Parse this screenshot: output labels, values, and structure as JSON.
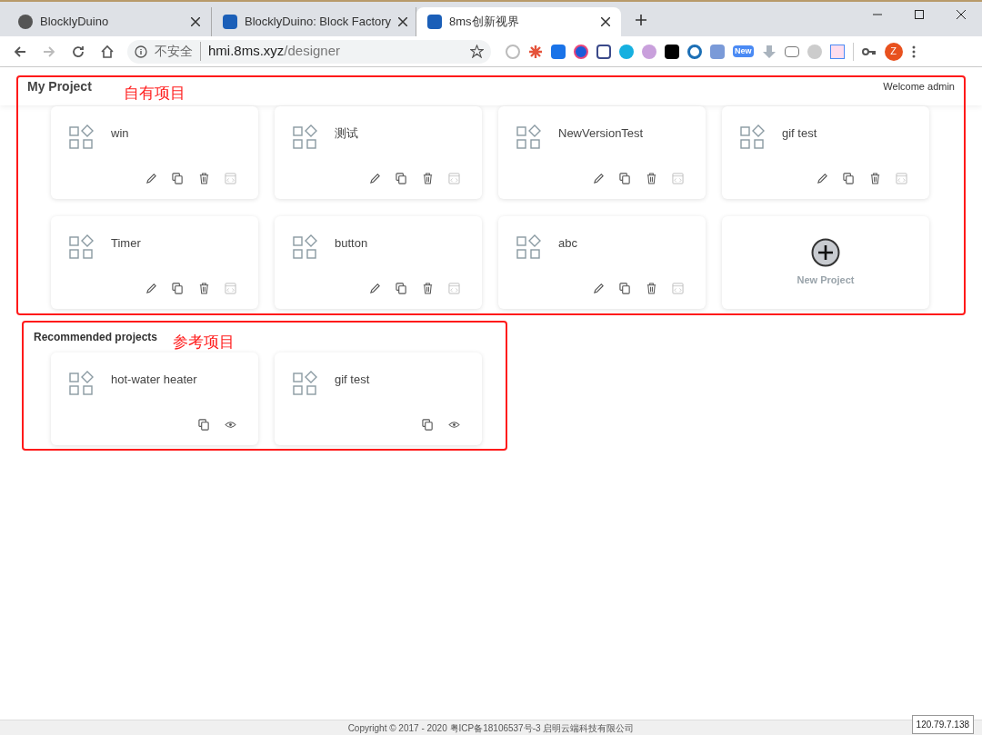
{
  "browser": {
    "tabs": [
      {
        "title": "BlocklyDuino",
        "selected": false
      },
      {
        "title": "BlocklyDuino: Block Factory",
        "selected": false
      },
      {
        "title": "8ms创新视界",
        "selected": true
      }
    ],
    "address": {
      "security": "不安全",
      "host": "hmi.8ms.xyz",
      "path": "/designer"
    },
    "extension_badge": "New",
    "avatar": "Z"
  },
  "header": {
    "title": "My Project",
    "welcome": "Welcome admin"
  },
  "my_projects": {
    "annotation": "自有项目",
    "items": [
      {
        "kind": "own",
        "name": "win"
      },
      {
        "kind": "own",
        "name": "测试"
      },
      {
        "kind": "own",
        "name": "NewVersionTest"
      },
      {
        "kind": "own",
        "name": "gif test"
      },
      {
        "kind": "own",
        "name": "Timer"
      },
      {
        "kind": "own",
        "name": "button"
      },
      {
        "kind": "own",
        "name": "abc"
      },
      {
        "kind": "new",
        "name": "New Project"
      }
    ]
  },
  "recommended": {
    "title": "Recommended projects",
    "annotation": "参考项目",
    "items": [
      {
        "kind": "shared",
        "name": "hot-water heater"
      },
      {
        "kind": "shared",
        "name": "gif test"
      }
    ]
  },
  "footer": "Copyright © 2017 - 2020 粤ICP备18106537号-3 启明云端科技有限公司",
  "ip_badge": "120.79.7.138"
}
